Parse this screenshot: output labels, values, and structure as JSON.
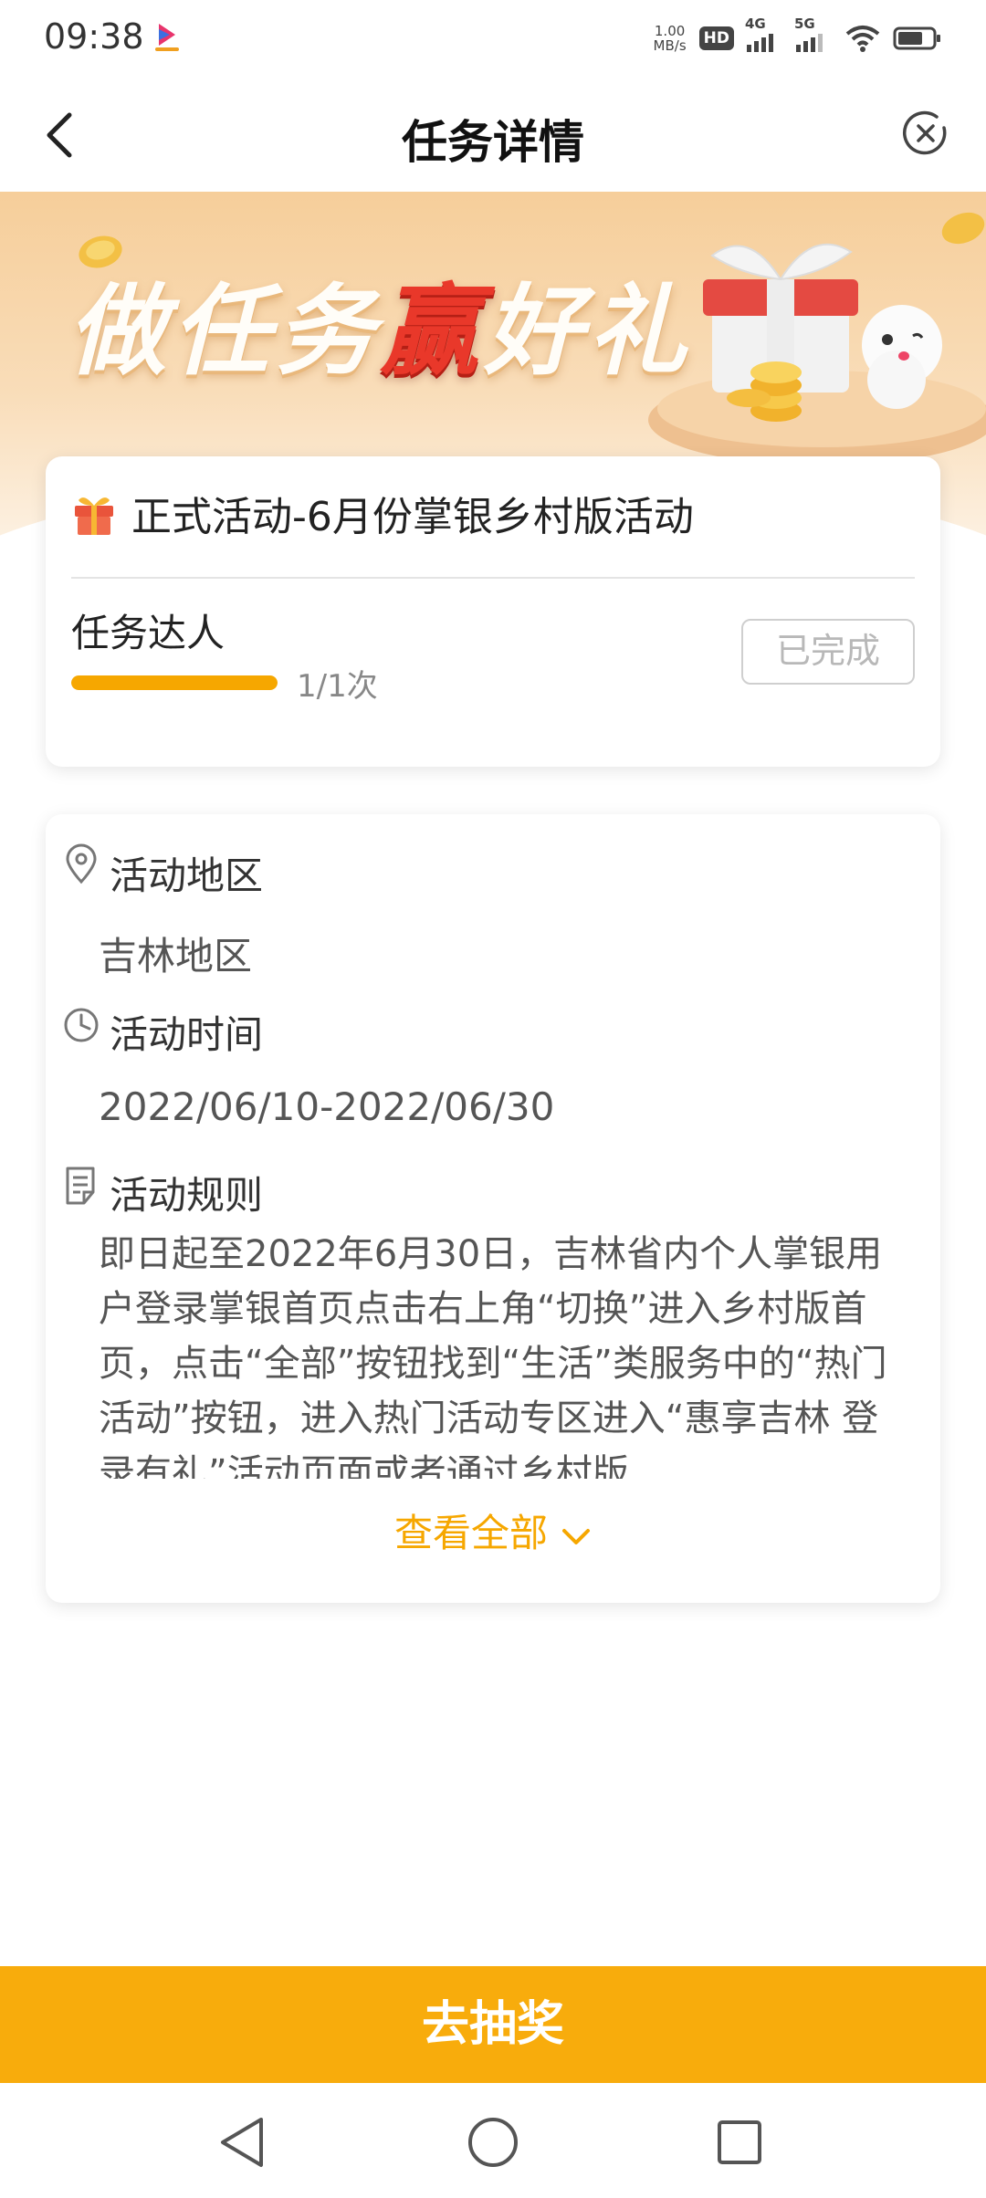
{
  "status_bar": {
    "time": "09:38",
    "net_speed_value": "1.00",
    "net_speed_unit": "MB/s",
    "hd_label": "HD",
    "sim1_label": "4G",
    "sim2_label": "5G"
  },
  "header": {
    "title": "任务详情"
  },
  "banner": {
    "slogan_part1": "做任务",
    "slogan_highlight": "赢",
    "slogan_part2": "好礼",
    "accent_color": "#e9382a"
  },
  "task_card": {
    "activity_title": "正式活动-6月份掌银乡村版活动",
    "task_name": "任务达人",
    "progress_fraction": 1.0,
    "progress_text": "1/1次",
    "status_button": "已完成"
  },
  "info_card": {
    "region_label": "活动地区",
    "region_value": "吉林地区",
    "time_label": "活动时间",
    "time_value": "2022/06/10-2022/06/30",
    "rules_label": "活动规则",
    "rules_text": "即日起至2022年6月30日，吉林省内个人掌银用户登录掌银首页点击右上角“切换”进入乡村版首页，点击“全部”按钮找到“生活”类服务中的“热门活动”按钮，进入热门活动专区进入“惠享吉林 登录有礼”活动页面或者通过乡村版",
    "view_all": "查看全部"
  },
  "footer": {
    "draw_button": "去抽奖",
    "button_color": "#f8ac0c"
  },
  "icons": [
    "back-arrow-icon",
    "close-circle-icon",
    "gift-icon",
    "location-pin-icon",
    "clock-icon",
    "document-icon",
    "chevron-down-icon",
    "nav-back-icon",
    "nav-home-icon",
    "nav-recents-icon"
  ]
}
